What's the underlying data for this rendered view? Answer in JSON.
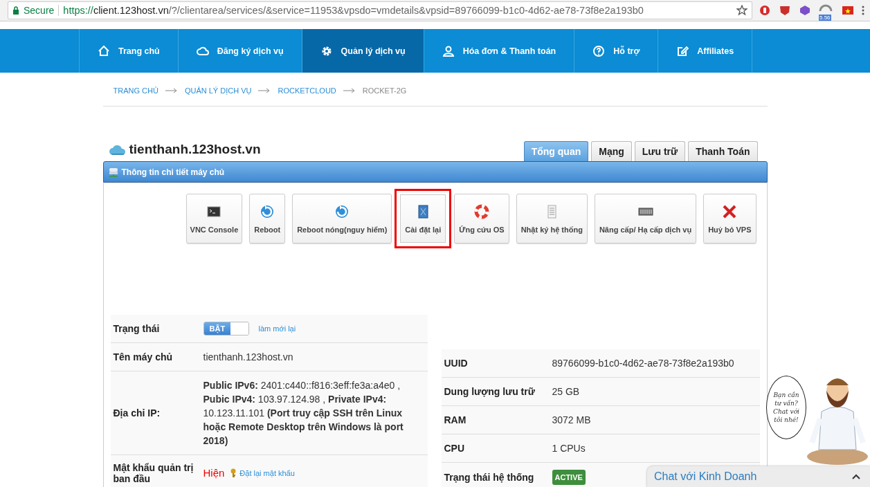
{
  "browser": {
    "secure_label": "Secure",
    "url_scheme": "https://",
    "url_host": "client.123host.vn",
    "url_path": "/?/clientarea/services/&service=11953&vpsdo=vmdetails&vpsid=89766099-b1c0-4d62-ae78-73f8e2a193b0",
    "badge": "5.56"
  },
  "nav": [
    {
      "label": "Trang chủ",
      "kind": "home",
      "selected": false
    },
    {
      "label": "Đăng ký dịch vụ",
      "kind": "cloud",
      "selected": false
    },
    {
      "label": "Quản lý dịch vụ",
      "kind": "gear",
      "selected": true
    },
    {
      "label": "Hóa đơn & Thanh toán",
      "kind": "user",
      "selected": false
    },
    {
      "label": "Hỗ trợ",
      "kind": "help",
      "selected": false
    },
    {
      "label": "Affiliates",
      "kind": "edit",
      "selected": false
    }
  ],
  "breadcrumb": [
    "TRANG CHỦ",
    "QUẢN LÝ DỊCH VỤ",
    "ROCKETCLOUD",
    "ROCKET-2G"
  ],
  "title": "tienthanh.123host.vn",
  "tabs": [
    {
      "label": "Tổng quan",
      "selected": true
    },
    {
      "label": "Mạng",
      "selected": false
    },
    {
      "label": "Lưu trữ",
      "selected": false
    },
    {
      "label": "Thanh Toán",
      "selected": false
    }
  ],
  "panel_title": "Thông tin chi tiết máy chủ",
  "actions": [
    {
      "label": "VNC Console",
      "kind": "console",
      "highlighted": false
    },
    {
      "label": "Reboot",
      "kind": "reboot",
      "highlighted": false
    },
    {
      "label": "Reboot nóng(nguy hiểm)",
      "kind": "reboot",
      "highlighted": false
    },
    {
      "label": "Cài đặt lại",
      "kind": "document",
      "highlighted": true
    },
    {
      "label": "Ứng cứu OS",
      "kind": "lifebuoy",
      "highlighted": false
    },
    {
      "label": "Nhật ký hệ thống",
      "kind": "log",
      "highlighted": false
    },
    {
      "label": "Nâng cấp/ Hạ cấp dịch vụ",
      "kind": "keyboard",
      "highlighted": false
    },
    {
      "label": "Huỷ bỏ VPS",
      "kind": "cross",
      "highlighted": false
    }
  ],
  "left_rows": [
    {
      "kind": "toggle",
      "label": "Trạng thái",
      "toggle_label": "BẬT",
      "on": true,
      "link": "làm mới lại"
    },
    {
      "kind": "text",
      "label": "Tên máy chủ",
      "value": "tienthanh.123host.vn"
    },
    {
      "kind": "rich",
      "label": "Địa chỉ IP:",
      "value": "**Public IPv6:** 2401:c440::f816:3eff:fe3a:a4e0 , **Pubic IPv4:** 103.97.124.98 , **Private IPv4:** 10.123.11.101 **(Port truy cập SSH trên Linux hoặc Remote Desktop trên Windows là port 2018)**"
    },
    {
      "kind": "password",
      "label": "Mật khẩu quản trị ban đầu",
      "value": "Hiện",
      "link": "Đặt lại mật khẩu"
    }
  ],
  "right_rows": [
    {
      "kind": "text",
      "label": "UUID",
      "value": "89766099-b1c0-4d62-ae78-73f8e2a193b0"
    },
    {
      "kind": "text",
      "label": "Dung lượng lưu trữ",
      "value": "25 GB"
    },
    {
      "kind": "text",
      "label": "RAM",
      "value": "3072 MB"
    },
    {
      "kind": "text",
      "label": "CPU",
      "value": "1 CPUs"
    },
    {
      "kind": "badge",
      "label": "Trạng thái hệ thống",
      "value": "ACTIVE"
    }
  ],
  "mascot": {
    "bubble": "Bạn cần tư vấn? Chat với tôi nhé!"
  },
  "chat": {
    "label": "Chat với Kinh Doanh"
  }
}
